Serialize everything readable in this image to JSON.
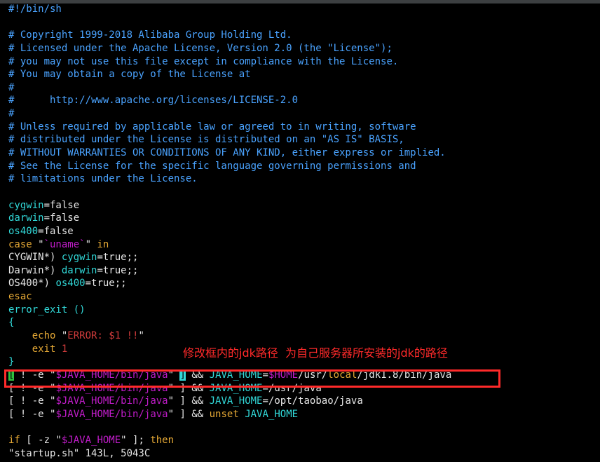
{
  "editor": {
    "shebang": "#!/bin/sh",
    "comments": [
      "# Copyright 1999-2018 Alibaba Group Holding Ltd.",
      "# Licensed under the Apache License, Version 2.0 (the \"License\");",
      "# you may not use this file except in compliance with the License.",
      "# You may obtain a copy of the License at",
      "#",
      "#      http://www.apache.org/licenses/LICENSE-2.0",
      "#",
      "# Unless required by applicable law or agreed to in writing, software",
      "# distributed under the License is distributed on an \"AS IS\" BASIS,",
      "# WITHOUT WARRANTIES OR CONDITIONS OF ANY KIND, either express or implied.",
      "# See the License for the specific language governing permissions and",
      "# limitations under the License."
    ],
    "code": {
      "cygwin_var": "cygwin",
      "cygwin_val": "=false",
      "darwin_var": "darwin",
      "darwin_val": "=false",
      "os400_var": "os400",
      "os400_val": "=false",
      "case_kw": "case",
      "case_q1": " \"",
      "case_uname": "`uname`",
      "case_q2": "\"",
      "case_in": " in",
      "cyg_pat": "CYGWIN*) ",
      "cyg_assign": "cygwin",
      "cyg_rest": "=true;;",
      "dar_pat": "Darwin*) ",
      "dar_assign": "darwin",
      "dar_rest": "=true;;",
      "os_pat": "OS400*) ",
      "os_assign": "os400",
      "os_rest": "=true;;",
      "esac": "esac",
      "func": "error_exit ()",
      "brace_open": "{",
      "echo_kw": "    echo ",
      "echo_q1": "\"",
      "echo_str": "ERROR: $1 !!",
      "echo_q2": "\"",
      "exit_kw": "    exit ",
      "exit_val": "1",
      "brace_close": "}",
      "l1_bracket": "[",
      "l1_a": " ! -e ",
      "l1_q1": "\"",
      "l1_var": "$JAVA_HOME",
      "l1_path": "/bin/java",
      "l1_q2": "\"",
      "l1_sp": " ",
      "l1_close": "]",
      "l1_and": " && ",
      "l1_jh": "JAVA_HOME",
      "l1_eq": "=",
      "l1_home": "$HOME",
      "l1_usr": "/usr/",
      "l1_local": "local",
      "l1_rest": "/jdk1.8/bin/java",
      "l2_open": "[ ! -e ",
      "l2_q1": "\"",
      "l2_var": "$JAVA_HOME",
      "l2_path": "/bin/java",
      "l2_q2": "\"",
      "l2_close": " ] && ",
      "l2_jh": "JAVA_HOME",
      "l2_val": "=/usr/java",
      "l3_open": "[ ! -e ",
      "l3_q1": "\"",
      "l3_var": "$JAVA_HOME",
      "l3_path": "/bin/java",
      "l3_q2": "\"",
      "l3_close": " ] && ",
      "l3_jh": "JAVA_HOME",
      "l3_val": "=/opt/taobao/java",
      "l4_open": "[ ! -e ",
      "l4_q1": "\"",
      "l4_var": "$JAVA_HOME",
      "l4_path": "/bin/java",
      "l4_q2": "\"",
      "l4_close": " ] && ",
      "l4_unset": "unset ",
      "l4_jh": "JAVA_HOME",
      "if_kw": "if",
      "if_a": " [ -z ",
      "if_q1": "\"",
      "if_var": "$JAVA_HOME",
      "if_q2": "\"",
      "if_b": " ]; ",
      "if_then": "then"
    },
    "status_line": "\"startup.sh\" 143L, 5043C"
  },
  "annotation": {
    "text": "修改框内的jdk路径  为自己服务器所安装的jdk的路径",
    "color": "#ff2a2a"
  }
}
